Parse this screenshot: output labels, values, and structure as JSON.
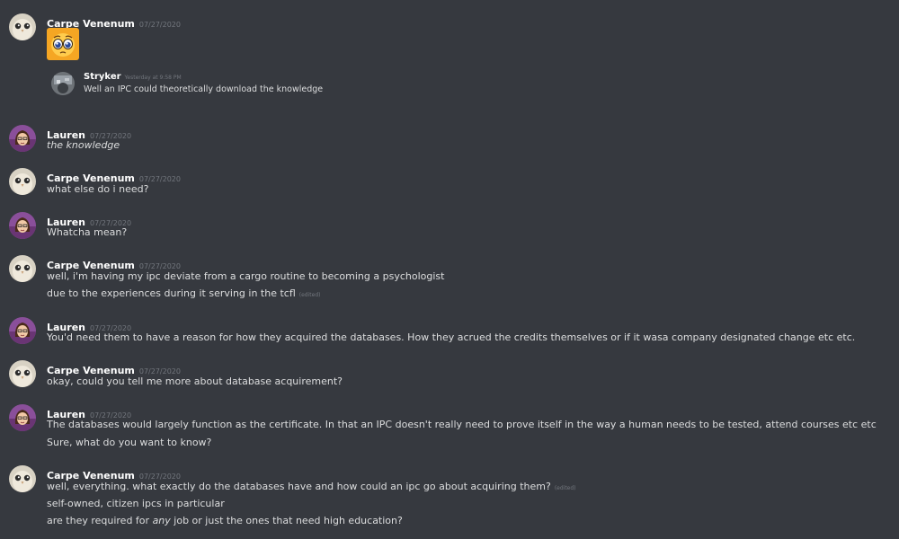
{
  "messages": [
    {
      "author": "Carpe Venenum",
      "timestamp": "07/27/2020",
      "avatar": "owl-avatar"
    },
    {
      "author": "Lauren",
      "timestamp": "07/27/2020",
      "avatar": "lauren-avatar",
      "lines": [
        "the knowledge"
      ]
    },
    {
      "author": "Carpe Venenum",
      "timestamp": "07/27/2020",
      "avatar": "owl-avatar",
      "lines": [
        "what else do i need?"
      ]
    },
    {
      "author": "Lauren",
      "timestamp": "07/27/2020",
      "avatar": "lauren-avatar",
      "lines": [
        "Whatcha mean?"
      ]
    },
    {
      "author": "Carpe Venenum",
      "timestamp": "07/27/2020",
      "avatar": "owl-avatar",
      "lines": [
        "well, i'm having my ipc deviate from a cargo routine to becoming a psychologist",
        "due to the experiences during it serving in the tcfl"
      ],
      "edited": "(edited)"
    },
    {
      "author": "Lauren",
      "timestamp": "07/27/2020",
      "avatar": "lauren-avatar",
      "lines": [
        "You'd need them to have a reason for how they acquired the databases. How they acrued the credits themselves or if it wasa company designated change etc etc."
      ]
    },
    {
      "author": "Carpe Venenum",
      "timestamp": "07/27/2020",
      "avatar": "owl-avatar",
      "lines": [
        "okay, could you tell me more about database acquirement?"
      ]
    },
    {
      "author": "Lauren",
      "timestamp": "07/27/2020",
      "avatar": "lauren-avatar",
      "lines": [
        "The databases would largely function as the certificate. In that an IPC doesn't really need to prove itself in the way a human needs to be tested, attend courses etc etc",
        "Sure, what do you want to know?"
      ]
    },
    {
      "author": "Carpe Venenum",
      "timestamp": "07/27/2020",
      "avatar": "owl-avatar",
      "lines": [
        "well, everything. what exactly do the databases have and how could an ipc go about acquiring them?",
        "self-owned, citizen ipcs in particular"
      ],
      "edited": "(edited)",
      "last_line": {
        "before": "are they required for ",
        "em": "any",
        "after": " job or just the ones that need high education?"
      }
    }
  ],
  "embed": {
    "author": "Stryker",
    "timestamp": "Yesterday at 9:58 PM",
    "text": "Well an IPC could theoretically download the knowledge",
    "avatar": "stryker-avatar"
  },
  "emoji": "pleading-face-emoji",
  "colors": {
    "background": "#36393f",
    "author": "#ffffff",
    "text": "#dcddde",
    "muted": "#72767d"
  }
}
